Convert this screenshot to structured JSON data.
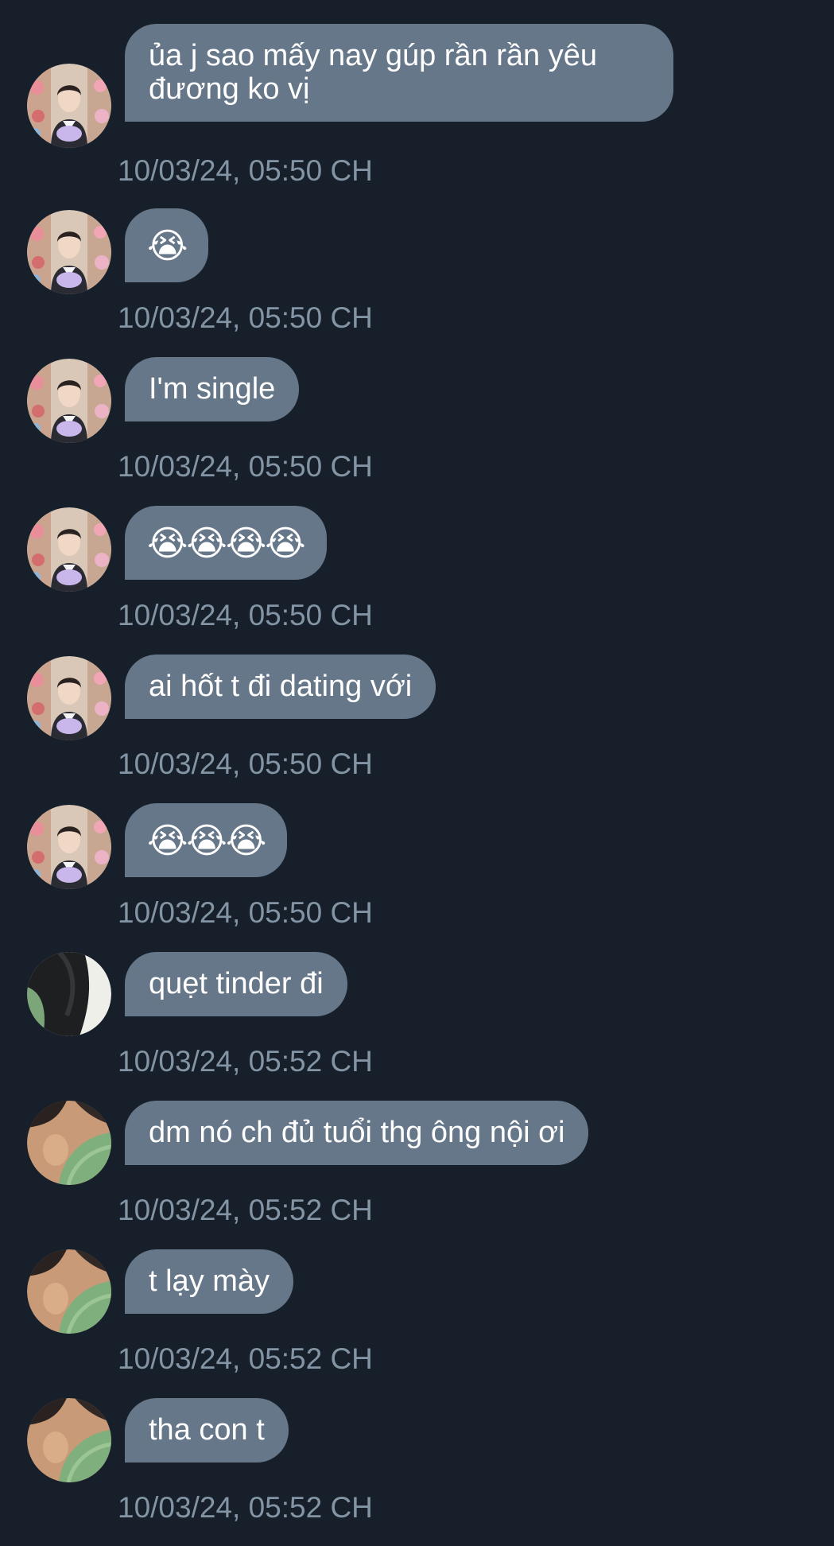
{
  "messages": [
    {
      "text": "ủa j sao mấy nay gúp rần rần yêu đương ko vị",
      "time": "10/03/24, 05:50 CH",
      "avatar": "avatar-boy-flowers"
    },
    {
      "text": "😭",
      "time": "10/03/24, 05:50 CH",
      "avatar": "avatar-boy-flowers"
    },
    {
      "text": "I'm single",
      "time": "10/03/24, 05:50 CH",
      "avatar": "avatar-boy-flowers"
    },
    {
      "text": "😭😭😭😭",
      "time": "10/03/24, 05:50 CH",
      "avatar": "avatar-boy-flowers"
    },
    {
      "text": "ai hốt t đi dating với",
      "time": "10/03/24, 05:50 CH",
      "avatar": "avatar-boy-flowers"
    },
    {
      "text": "😭😭😭",
      "time": "10/03/24, 05:50 CH",
      "avatar": "avatar-boy-flowers"
    },
    {
      "text": "quẹt tinder đi",
      "time": "10/03/24, 05:52 CH",
      "avatar": "avatar-dark-green"
    },
    {
      "text": "dm nó ch đủ tuổi thg ông nội ơi",
      "time": "10/03/24, 05:52 CH",
      "avatar": "avatar-skin-green"
    },
    {
      "text": "t lạy mày",
      "time": "10/03/24, 05:52 CH",
      "avatar": "avatar-skin-green"
    },
    {
      "text": "tha con t",
      "time": "10/03/24, 05:52 CH",
      "avatar": "avatar-skin-green"
    }
  ],
  "colors": {
    "background": "#17202a",
    "bubble": "#66778a",
    "bubble_text": "#ffffff",
    "timestamp": "#8394a5"
  }
}
